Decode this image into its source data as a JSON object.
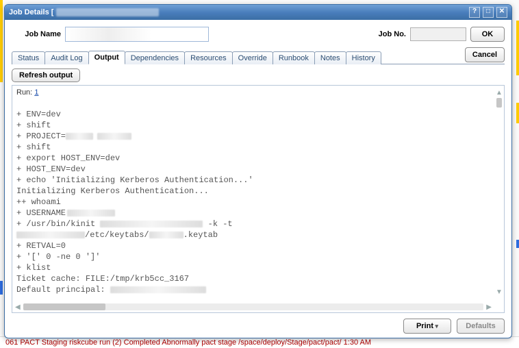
{
  "titlebar": {
    "title": "Job Details ["
  },
  "header": {
    "jobname_label": "Job Name",
    "jobname_value": "",
    "jobno_label": "Job No.",
    "jobno_value": "",
    "ok_label": "OK"
  },
  "tabs": [
    {
      "label": "Status"
    },
    {
      "label": "Audit Log"
    },
    {
      "label": "Output",
      "active": true
    },
    {
      "label": "Dependencies"
    },
    {
      "label": "Resources"
    },
    {
      "label": "Override"
    },
    {
      "label": "Runbook"
    },
    {
      "label": "Notes"
    },
    {
      "label": "History"
    }
  ],
  "buttons": {
    "cancel": "Cancel",
    "refresh": "Refresh output",
    "print": "Print",
    "defaults": "Defaults"
  },
  "output": {
    "run_label": "Run:",
    "run_link": "1",
    "lines": [
      "",
      "+ ENV=dev",
      "+ shift",
      "+ PROJECT=",
      "+ shift",
      "+ export HOST_ENV=dev",
      "+ HOST_ENV=dev",
      "+ echo 'Initializing Kerberos Authentication...'",
      "Initializing Kerberos Authentication...",
      "++ whoami",
      "+ USERNAME",
      "+ /usr/bin/kinit                          -k -t",
      "              /etc/keytabs/        .keytab",
      "+ RETVAL=0",
      "+ '[' 0 -ne 0 ']'",
      "+ klist",
      "Ticket cache: FILE:/tmp/krb5cc_3167",
      "Default principal:"
    ]
  },
  "backdrop": {
    "row_text": "061 PACT Staging riskcube run (2)             Completed Abnormally   pact stage /space/deploy/Stage/pact/pact/  1:30 AM"
  }
}
